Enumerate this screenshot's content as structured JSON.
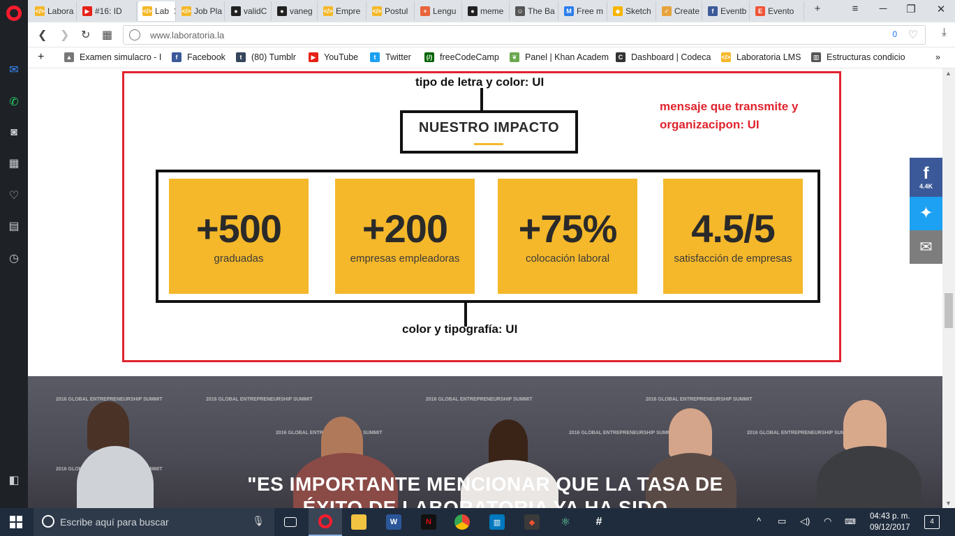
{
  "tabs": [
    {
      "label": "Labora",
      "fav": "#f5b82a",
      "glyph": "</>"
    },
    {
      "label": "#16: ID",
      "fav": "#e62117",
      "glyph": "▶"
    },
    {
      "label": "Lab",
      "fav": "#f5b82a",
      "glyph": "</>"
    },
    {
      "label": "Job Pla",
      "fav": "#f5b82a",
      "glyph": "</>"
    },
    {
      "label": "validC",
      "fav": "#222",
      "glyph": "●"
    },
    {
      "label": "vaneg",
      "fav": "#222",
      "glyph": "●"
    },
    {
      "label": "Empre",
      "fav": "#f5b82a",
      "glyph": "</>"
    },
    {
      "label": "Postul",
      "fav": "#f5b82a",
      "glyph": "</>"
    },
    {
      "label": "Lengu",
      "fav": "#e8643c",
      "glyph": "+"
    },
    {
      "label": "meme",
      "fav": "#222",
      "glyph": "●"
    },
    {
      "label": "The Ba",
      "fav": "#555",
      "glyph": "☺"
    },
    {
      "label": "Free m",
      "fav": "#2b7de9",
      "glyph": "M"
    },
    {
      "label": "Sketch",
      "fav": "#f7b500",
      "glyph": "◆"
    },
    {
      "label": "Create",
      "fav": "#e6a23c",
      "glyph": "✓"
    },
    {
      "label": "Eventb",
      "fav": "#3b5998",
      "glyph": "f"
    },
    {
      "label": "Evento",
      "fav": "#f05537",
      "glyph": "E"
    }
  ],
  "address": {
    "url": "www.laboratoria.la",
    "blocked_count": "0"
  },
  "bookmarks": [
    {
      "label": "Examen simulacro - I",
      "fav": "#777",
      "glyph": "▲"
    },
    {
      "label": "Facebook",
      "fav": "#3b5998",
      "glyph": "f"
    },
    {
      "label": "(80) Tumblr",
      "fav": "#36465d",
      "glyph": "t"
    },
    {
      "label": "YouTube",
      "fav": "#e62117",
      "glyph": "▶"
    },
    {
      "label": "Twitter",
      "fav": "#1da1f2",
      "glyph": "t"
    },
    {
      "label": "freeCodeCamp",
      "fav": "#006400",
      "glyph": "(/)"
    },
    {
      "label": "Panel | Khan Academ",
      "fav": "#6aa84f",
      "glyph": "❦"
    },
    {
      "label": "Dashboard | Codeca",
      "fav": "#333",
      "glyph": "C"
    },
    {
      "label": "Laboratoria LMS",
      "fav": "#f5b82a",
      "glyph": "</>"
    },
    {
      "label": "Estructuras condicio",
      "fav": "#555",
      "glyph": "▥"
    }
  ],
  "annotations": {
    "top": "tipo de letra y color: UI",
    "right_line1": "mensaje que transmite y",
    "right_line2": "organizacipon: UI",
    "bottom": "color y tipografía: UI"
  },
  "impact": {
    "title": "NUESTRO IMPACTO"
  },
  "stats": [
    {
      "value": "+500",
      "label": "graduadas"
    },
    {
      "value": "+200",
      "label": "empresas empleadoras"
    },
    {
      "value": "+75%",
      "label": "colocación laboral"
    },
    {
      "value": "4.5/5",
      "label": "satisfacción de empresas"
    }
  ],
  "hero": {
    "quote_line1": "\"ES IMPORTANTE MENCIONAR QUE LA TASA DE",
    "quote_line2": "ÉXITO DE LABORATORIA YA HA SIDO",
    "badge_text": "2016 GLOBAL ENTREPRENEURSHIP SUMMIT"
  },
  "share": {
    "facebook_count": "4.4K"
  },
  "taskbar": {
    "search_placeholder": "Escribe aquí para buscar",
    "time": "04:43 p. m.",
    "date": "09/12/2017",
    "notifications": "4"
  },
  "colors": {
    "accent": "#f5b82a",
    "annotation_red": "#e0232d",
    "facebook": "#3b5998",
    "twitter": "#1da1f2"
  }
}
